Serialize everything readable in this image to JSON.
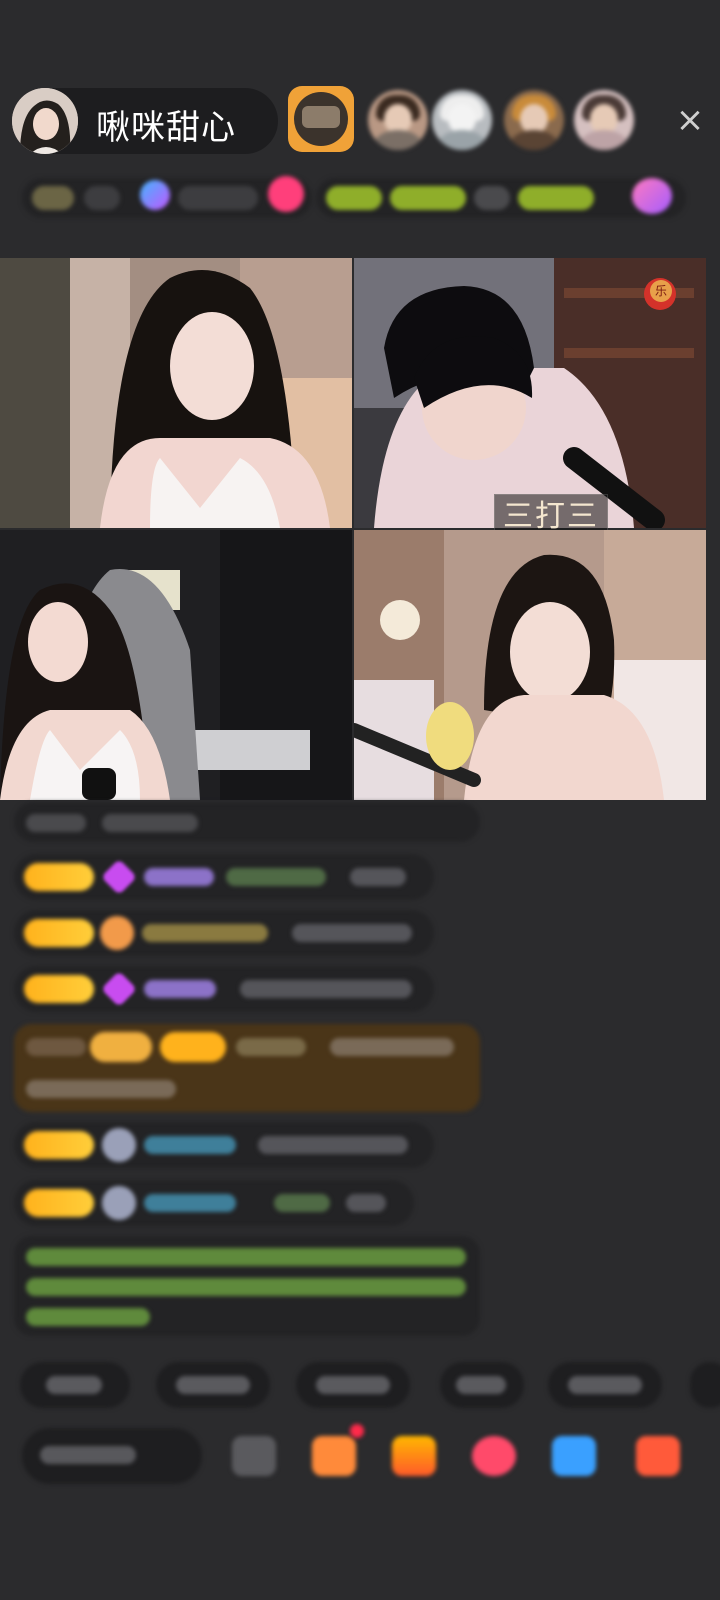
{
  "header": {
    "host_name": "啾咪甜心",
    "rank_avatars": [
      "rank-avatar-1",
      "rank-avatar-2",
      "rank-avatar-3",
      "rank-avatar-4",
      "rank-avatar-5"
    ],
    "close_icon": "close-icon"
  },
  "pk": {
    "label": "三打三"
  },
  "colors": {
    "background": "#2b2b2d",
    "level_badge": "#ffb21c",
    "green_text": "#9ad66a",
    "purple_gem": "#c84cf0"
  }
}
